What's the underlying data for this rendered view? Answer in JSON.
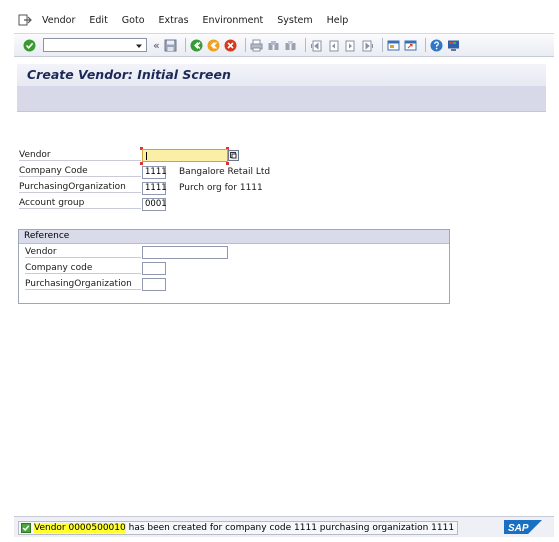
{
  "menu": {
    "items": [
      "Vendor",
      "Edit",
      "Goto",
      "Extras",
      "Environment",
      "System",
      "Help"
    ]
  },
  "toolbar": {
    "command_field_value": "",
    "collapse_glyph": "«",
    "icons": [
      "enter-icon",
      "save-icon",
      "back-icon",
      "exit-icon",
      "cancel-icon",
      "print-icon",
      "find-icon",
      "find-next-icon",
      "first-page-icon",
      "previous-page-icon",
      "next-page-icon",
      "last-page-icon",
      "create-session-icon",
      "shortcut-icon",
      "help-icon",
      "customize-layout-icon"
    ]
  },
  "title": "Create Vendor:  Initial Screen",
  "form": {
    "vendor_label": "Vendor",
    "vendor_value": "",
    "company_code_label": "Company Code",
    "company_code_value": "1111",
    "company_code_desc": "Bangalore Retail Ltd",
    "purch_org_label": "PurchasingOrganization",
    "purch_org_value": "1111",
    "purch_org_desc": "Purch org for 1111",
    "account_group_label": "Account group",
    "account_group_value": "0001"
  },
  "reference": {
    "title": "Reference",
    "vendor_label": "Vendor",
    "vendor_value": "",
    "company_code_label": "Company code",
    "company_code_value": "",
    "purch_org_label": "PurchasingOrganization",
    "purch_org_value": ""
  },
  "status": {
    "highlight": "Vendor 0000500010",
    "message_rest": " has been created for company code 1111 purchasing organization 1111",
    "logo_text": "SAP"
  },
  "colors": {
    "required_field": "#fbeea6",
    "highlight": "#ffff33",
    "title_text": "#1c2a55",
    "sap_blue": "#1b6fc0"
  }
}
